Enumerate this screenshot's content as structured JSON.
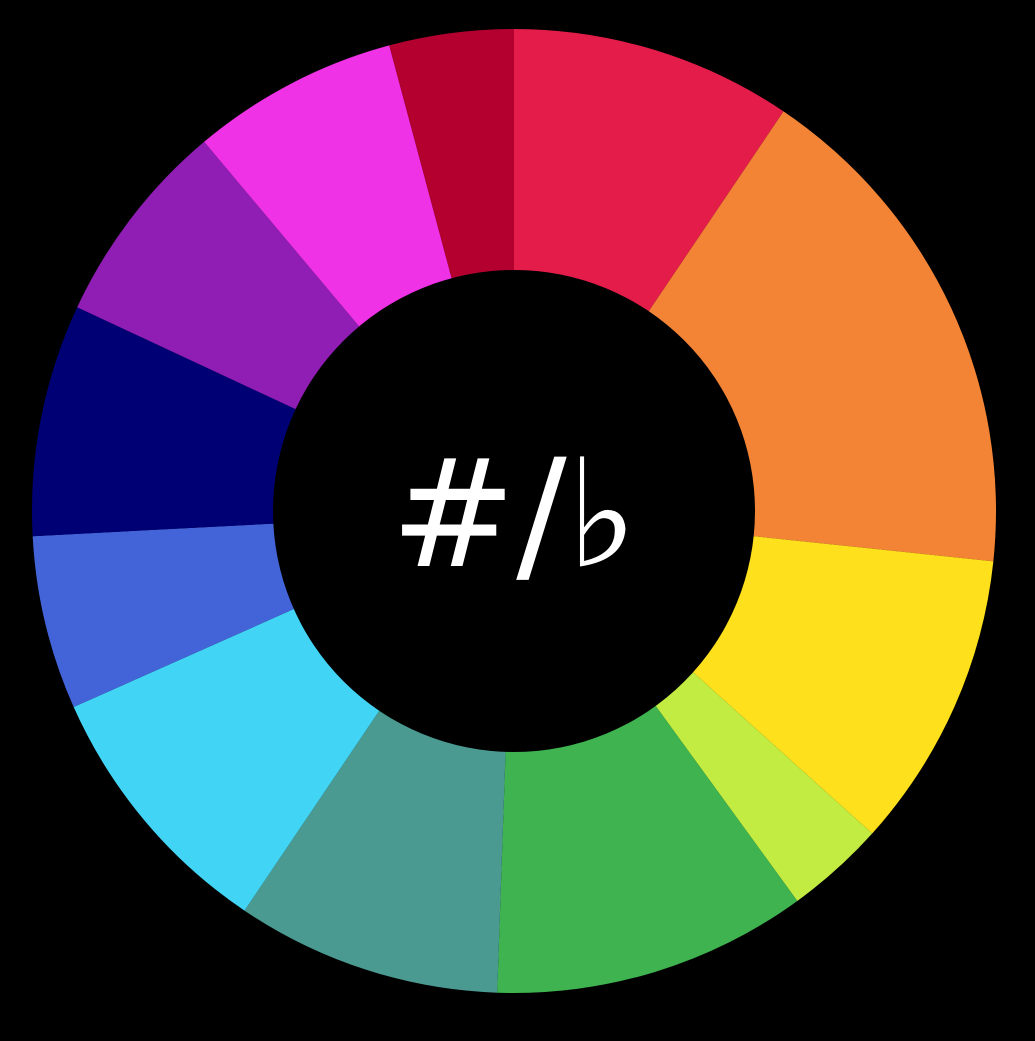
{
  "wheel": {
    "center_label": "#/♭",
    "segments": [
      {
        "name": "segment-crimson",
        "color": "#E31C4A",
        "sweep_deg": 34
      },
      {
        "name": "segment-orange",
        "color": "#F38435",
        "sweep_deg": 62
      },
      {
        "name": "segment-yellow",
        "color": "#FFE01C",
        "sweep_deg": 36
      },
      {
        "name": "segment-lime",
        "color": "#C2EC42",
        "sweep_deg": 12
      },
      {
        "name": "segment-green",
        "color": "#3EB34F",
        "sweep_deg": 38
      },
      {
        "name": "segment-teal",
        "color": "#4A9A91",
        "sweep_deg": 32
      },
      {
        "name": "segment-sky-blue",
        "color": "#42D4F4",
        "sweep_deg": 32
      },
      {
        "name": "segment-royal-blue",
        "color": "#4364D8",
        "sweep_deg": 21
      },
      {
        "name": "segment-navy",
        "color": "#000075",
        "sweep_deg": 28
      },
      {
        "name": "segment-purple",
        "color": "#911EB4",
        "sweep_deg": 25
      },
      {
        "name": "segment-magenta",
        "color": "#F032E6",
        "sweep_deg": 25
      },
      {
        "name": "segment-maroon",
        "color": "#B3002E",
        "sweep_deg": 15
      }
    ]
  }
}
